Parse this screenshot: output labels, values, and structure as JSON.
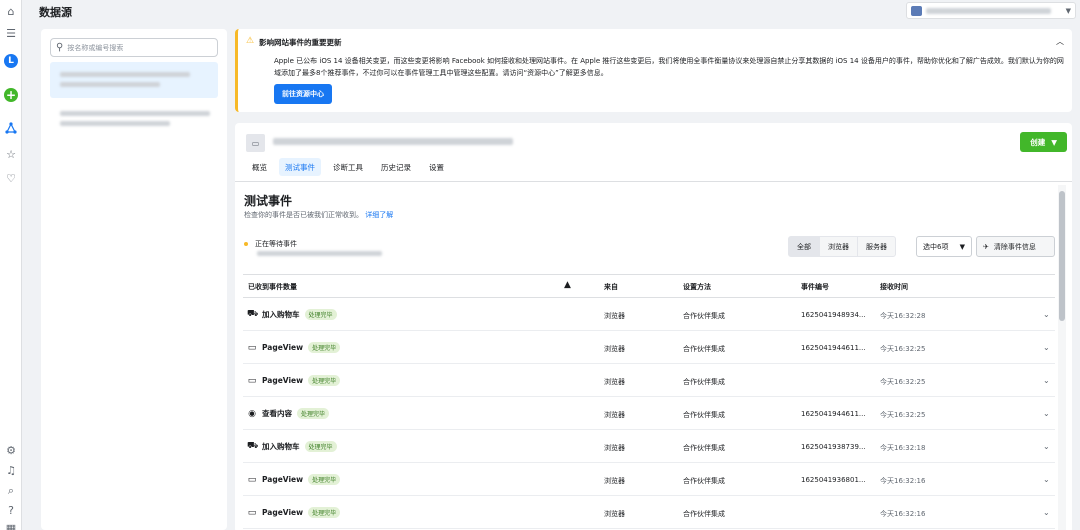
{
  "page_title": "数据源",
  "rail_icons": [
    "home-icon",
    "menu-icon",
    "avatar",
    "add-icon",
    "events-manager-icon",
    "star-icon",
    "partner-icon",
    "settings-icon",
    "bell-icon",
    "search-icon",
    "help-icon",
    "grid-icon"
  ],
  "avatar_letter": "L",
  "source_search": {
    "placeholder": "按名称或编号搜索"
  },
  "notice": {
    "title": "影响网站事件的重要更新",
    "body": "Apple 已公布 iOS 14 设备相关变更，而这些变更将影响 Facebook 如何接收和处理网站事件。在 Apple 推行这些变更后，我们将使用全事件衡量协议来处理源自禁止分享其数据的 iOS 14 设备用户的事件，帮助你优化和了解广告成效。我们默认为你的网域添加了最多8个推荐事件，不过你可以在事件管理工具中管理这些配置。请访问“资源中心”了解更多信息。",
    "button": "前往资源中心"
  },
  "main": {
    "create_button": "创建",
    "tabs": [
      "概览",
      "测试事件",
      "诊断工具",
      "历史记录",
      "设置"
    ],
    "active_tab": "测试事件",
    "section_title": "测试事件",
    "section_desc": "检查你的事件是否已被我们正常收到。",
    "section_link": "详细了解",
    "waiting_text": "正在等待事件",
    "filters": [
      "全部",
      "浏览器",
      "服务器"
    ],
    "select_label": "选中6项",
    "clear_label": "清除事件信息",
    "columns": [
      "已收到事件数量",
      "来自",
      "设置方法",
      "事件编号",
      "接收时间"
    ],
    "rows": [
      {
        "icon": "cart-icon",
        "name": "加入购物车",
        "status": "处理完毕",
        "source": "浏览器",
        "method": "合作伙伴集成",
        "event_id": "1625041948934...",
        "time": "今天16:32:28"
      },
      {
        "icon": "page-icon",
        "name": "PageView",
        "status": "处理完毕",
        "source": "浏览器",
        "method": "合作伙伴集成",
        "event_id": "1625041944611...",
        "time": "今天16:32:25"
      },
      {
        "icon": "page-icon",
        "name": "PageView",
        "status": "处理完毕",
        "source": "浏览器",
        "method": "合作伙伴集成",
        "event_id": "",
        "time": "今天16:32:25"
      },
      {
        "icon": "eye-icon",
        "name": "查看内容",
        "status": "处理完毕",
        "source": "浏览器",
        "method": "合作伙伴集成",
        "event_id": "1625041944611...",
        "time": "今天16:32:25"
      },
      {
        "icon": "cart-icon",
        "name": "加入购物车",
        "status": "处理完毕",
        "source": "浏览器",
        "method": "合作伙伴集成",
        "event_id": "1625041938739...",
        "time": "今天16:32:18"
      },
      {
        "icon": "page-icon",
        "name": "PageView",
        "status": "处理完毕",
        "source": "浏览器",
        "method": "合作伙伴集成",
        "event_id": "1625041936801...",
        "time": "今天16:32:16"
      },
      {
        "icon": "page-icon",
        "name": "PageView",
        "status": "处理完毕",
        "source": "浏览器",
        "method": "合作伙伴集成",
        "event_id": "",
        "time": "今天16:32:16"
      }
    ]
  },
  "colors": {
    "primary": "#1877f2",
    "success": "#42b72a",
    "warning": "#f7b928"
  }
}
